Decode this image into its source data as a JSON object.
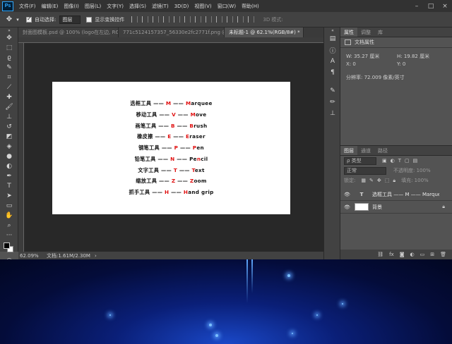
{
  "menubar": {
    "logo": "Ps",
    "items": [
      "文件(F)",
      "编辑(E)",
      "图像(I)",
      "图层(L)",
      "文字(Y)",
      "选择(S)",
      "滤镜(T)",
      "3D(D)",
      "视图(V)",
      "窗口(W)",
      "帮助(H)"
    ]
  },
  "options": {
    "auto_select_label": "自动选择:",
    "auto_select_value": "图层",
    "transform_label": "显示变换控件",
    "mode3d_label": "3D 模式:"
  },
  "tabs": [
    {
      "label": "封面图模板.psd @ 100% (logo在左边, RGB...",
      "close": "×"
    },
    {
      "label": "771c5124157357_56330e2fc2771f.png @ 1...",
      "close": "×"
    },
    {
      "label": "未标题-1 @ 62.1%(RGB/8#) *",
      "close": "×"
    }
  ],
  "document_lines": [
    {
      "pre": "选框工具 —— ",
      "key": "M",
      "mid": " —— ",
      "key2": "M",
      "post": "arquee"
    },
    {
      "pre": "移动工具 —— ",
      "key": "V",
      "mid": " —— ",
      "key2": "M",
      "post": "ove"
    },
    {
      "pre": "画笔工具 —— ",
      "key": "B",
      "mid": " —— ",
      "key2": "B",
      "post": "rush"
    },
    {
      "pre": "橡皮擦 —— ",
      "key": "E",
      "mid": " —— ",
      "key2": "E",
      "post": "raser"
    },
    {
      "pre": "钢笔工具 —— ",
      "key": "P",
      "mid": " —— ",
      "key2": "P",
      "post": "en"
    },
    {
      "pre": "铅笔工具 —— ",
      "key": "N",
      "mid": " —— ",
      "key2": "",
      "post": "Pe",
      "key3": "n",
      "post3": "cil"
    },
    {
      "pre": "文字工具 —— ",
      "key": "T",
      "mid": " —— ",
      "key2": "T",
      "post": "ext"
    },
    {
      "pre": "缩放工具 —— ",
      "key": "Z",
      "mid": " —— ",
      "key2": "Z",
      "post": "oom"
    },
    {
      "pre": "抓手工具 —— ",
      "key": "H",
      "mid": " —— ",
      "key2": "H",
      "post": "and grip"
    }
  ],
  "status": {
    "zoom": "62.09%",
    "doc_info": "文档:1.61M/2.30M",
    "arrow": "›"
  },
  "properties": {
    "tabs": [
      "属性",
      "调整",
      "库"
    ],
    "header": "文档属性",
    "w_label": "W:  35.27 厘米",
    "h_label": "H:  19.82 厘米",
    "x_label": "X:  0",
    "y_label": "Y:  0",
    "resolution": "分辨率: 72.009 像素/英寸"
  },
  "layers_panel": {
    "tabs": [
      "图层",
      "通道",
      "路径"
    ],
    "kind_select": "ρ 类型",
    "blend_select": "正常",
    "opacity_label": "不透明度: 100%",
    "lock_label": "锁定:",
    "fill_label": "填充: 100%",
    "layers": [
      {
        "name": "选框工具 —— M —— Marquee ...",
        "thumb": "T",
        "selected": false
      },
      {
        "name": "背景",
        "thumb": "",
        "selected": false
      }
    ]
  },
  "colors": {
    "accent_red": "#e01010",
    "ps_blue": "#31a8ff"
  }
}
